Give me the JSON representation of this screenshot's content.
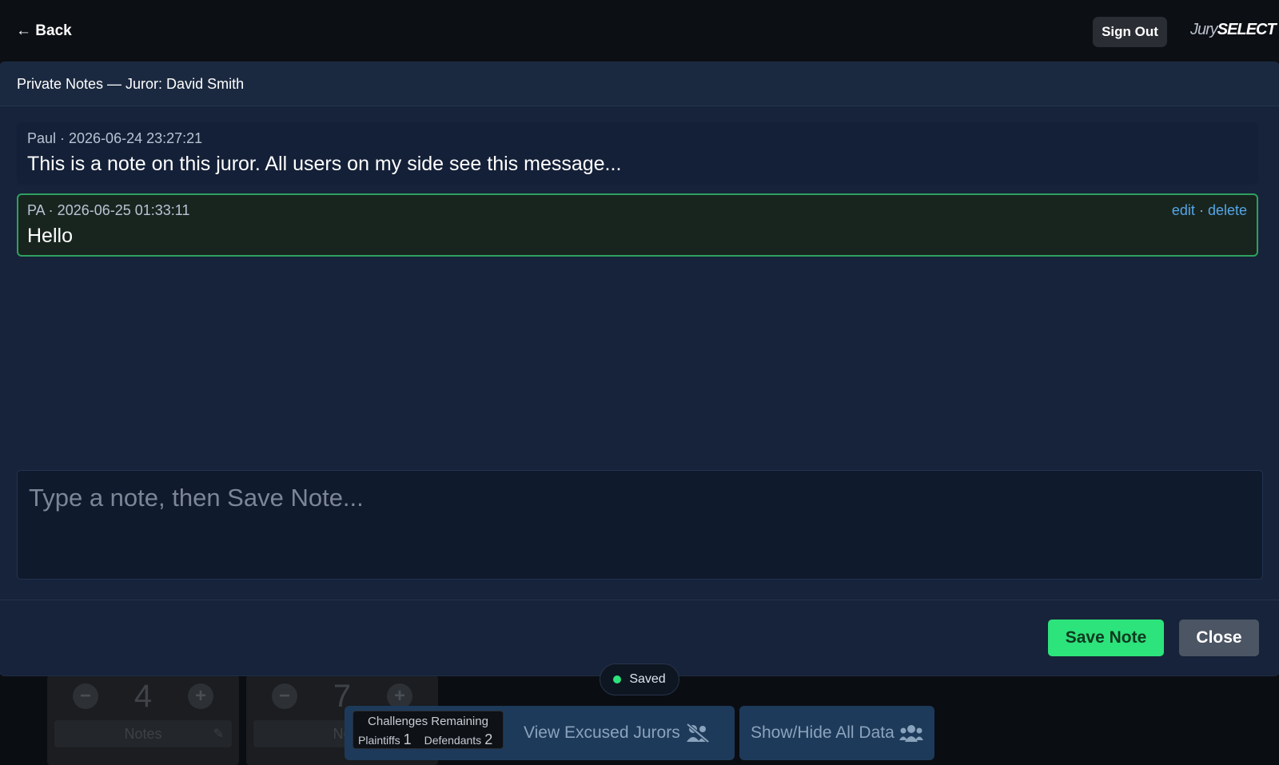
{
  "topbar": {
    "back_label": "← Back",
    "signout_label": "Sign Out",
    "logo_jury": "Jury",
    "logo_select": "SELECT"
  },
  "modal": {
    "title": "Private Notes — Juror: David Smith",
    "notes": [
      {
        "meta": "Paul · 2026-06-24 23:27:21",
        "text": "This is a note on this juror. All users on my side see this message..."
      },
      {
        "meta": "PA · 2026-06-25 01:33:11",
        "text": "Hello",
        "edit_label": "edit",
        "sep": "·",
        "delete_label": "delete"
      }
    ],
    "compose": {
      "value": "",
      "placeholder": "Type a note, then Save Note..."
    },
    "save_label": "Save Note",
    "close_label": "Close"
  },
  "status": {
    "saved_label": "Saved",
    "dot_color": "#2de37b"
  },
  "background": {
    "counters": [
      {
        "value": "4",
        "notes_label": "Notes"
      },
      {
        "value": "7",
        "notes_label": "No"
      }
    ],
    "challenges": {
      "title": "Challenges Remaining",
      "plaintiffs_label": "Plaintiffs",
      "plaintiffs_value": "1",
      "defendants_label": "Defendants",
      "defendants_value": "2"
    },
    "view_excused_label": "View Excused Jurors",
    "show_hide_label": "Show/Hide All Data"
  },
  "colors": {
    "accent_green": "#2de37b",
    "link_blue": "#55a6e6",
    "modal_bg": "#17233a"
  }
}
